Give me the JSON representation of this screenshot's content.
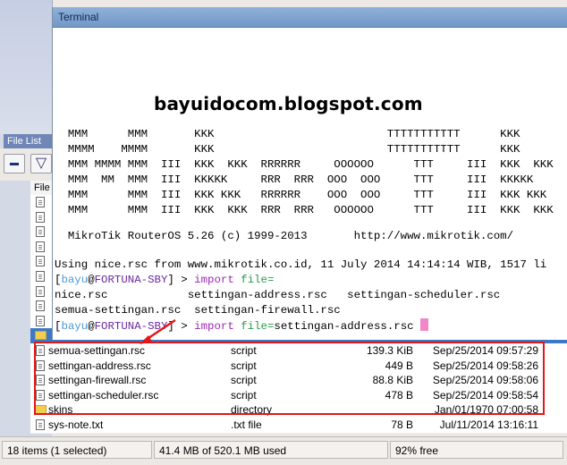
{
  "filelist": {
    "panel_title": "File List",
    "column_file": "File",
    "rows": [
      {
        "icon": "document-icon",
        "name": "",
        "type": "",
        "size": "",
        "date": ""
      },
      {
        "icon": "document-icon",
        "name": "",
        "type": "",
        "size": "",
        "date": ""
      },
      {
        "icon": "document-icon",
        "name": "",
        "type": "",
        "size": "",
        "date": ""
      },
      {
        "icon": "document-icon",
        "name": "",
        "type": "",
        "size": "",
        "date": ""
      },
      {
        "icon": "document-icon",
        "name": "",
        "type": "",
        "size": "",
        "date": ""
      },
      {
        "icon": "document-icon",
        "name": "",
        "type": "",
        "size": "",
        "date": ""
      },
      {
        "icon": "document-icon",
        "name": "",
        "type": "",
        "size": "",
        "date": ""
      },
      {
        "icon": "document-icon",
        "name": "",
        "type": "",
        "size": "",
        "date": ""
      },
      {
        "icon": "document-icon",
        "name": "",
        "type": "",
        "size": "",
        "date": ""
      },
      {
        "icon": "folder-icon",
        "name": "",
        "type": "",
        "size": "",
        "date": ""
      },
      {
        "icon": "document-icon",
        "name": "semua-settingan.rsc",
        "type": "script",
        "size": "139.3 KiB",
        "date": "Sep/25/2014 09:57:29"
      },
      {
        "icon": "document-icon",
        "name": "settingan-address.rsc",
        "type": "script",
        "size": "449 B",
        "date": "Sep/25/2014 09:58:26"
      },
      {
        "icon": "document-icon",
        "name": "settingan-firewall.rsc",
        "type": "script",
        "size": "88.8 KiB",
        "date": "Sep/25/2014 09:58:06"
      },
      {
        "icon": "document-icon",
        "name": "settingan-scheduler.rsc",
        "type": "script",
        "size": "478 B",
        "date": "Sep/25/2014 09:58:54"
      },
      {
        "icon": "folder-icon",
        "name": "skins",
        "type": "directory",
        "size": "",
        "date": "Jan/01/1970 07:00:58"
      },
      {
        "icon": "document-icon",
        "name": "sys-note.txt",
        "type": ".txt file",
        "size": "78 B",
        "date": "Jul/11/2014 13:16:11"
      }
    ],
    "status": {
      "items": "18 items (1 selected)",
      "usage": "41.4 MB of 520.1 MB used",
      "free": "92% free"
    }
  },
  "terminal": {
    "title": "Terminal",
    "watermark": "bayuidocom.blogspot.com",
    "banner": [
      "  MMM      MMM       KKK                          TTTTTTTTTTT      KKK",
      "  MMMM    MMMM       KKK                          TTTTTTTTTTT      KKK",
      "  MMM MMMM MMM  III  KKK  KKK  RRRRRR     OOOOOO      TTT     III  KKK  KKK",
      "  MMM  MM  MMM  III  KKKKK     RRR  RRR  OOO  OOO     TTT     III  KKKKK",
      "  MMM      MMM  III  KKK KKK   RRRRRR    OOO  OOO     TTT     III  KKK KKK",
      "  MMM      MMM  III  KKK  KKK  RRR  RRR   OOOOOO      TTT     III  KKK  KKK"
    ],
    "version_line": "  MikroTik RouterOS 5.26 (c) 1999-2013       http://www.mikrotik.com/",
    "info_line": "Using nice.rsc from www.mikrotik.co.id, 11 July 2014 14:14:14 WIB, 1517 li",
    "prompt_open": "[",
    "prompt_user": "bayu",
    "prompt_at": "@",
    "prompt_host": "FORTUNA-SBY",
    "prompt_close": "] >",
    "cmd_import": "import",
    "cmd_file": "file=",
    "completion_line1": "nice.rsc            settingan-address.rsc   settingan-scheduler.rsc",
    "completion_line2": "semua-settingan.rsc  settingan-firewall.rsc",
    "cmd_argument": "settingan-address.rsc"
  },
  "colors": {
    "annotation": "#e41616",
    "selected_row": "#3b78c8",
    "prompt_user": "#4b9ad8",
    "prompt_host": "#6a2aa0",
    "keyword_import": "#9b2ab2",
    "keyword_file": "#2a9a4a",
    "cursor": "#f088c8"
  }
}
